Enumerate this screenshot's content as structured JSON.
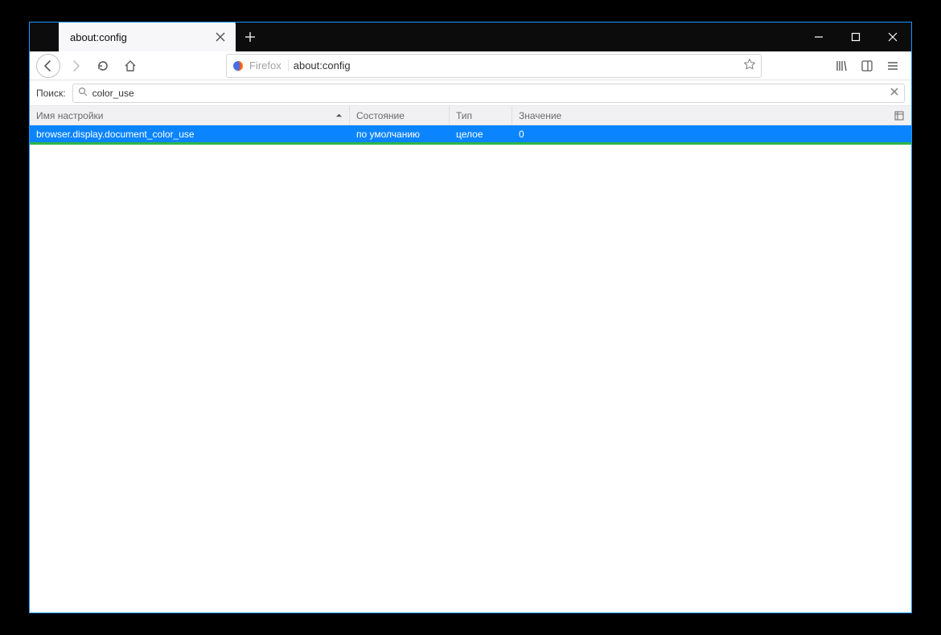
{
  "window": {
    "tab_title": "about:config"
  },
  "urlbar": {
    "brand": "Firefox",
    "url": "about:config"
  },
  "search": {
    "label": "Поиск:",
    "value": "color_use"
  },
  "table": {
    "headers": {
      "name": "Имя настройки",
      "state": "Состояние",
      "type": "Тип",
      "value": "Значение"
    },
    "rows": [
      {
        "name": "browser.display.document_color_use",
        "state": "по умолчанию",
        "type": "целое",
        "value": "0"
      }
    ]
  }
}
